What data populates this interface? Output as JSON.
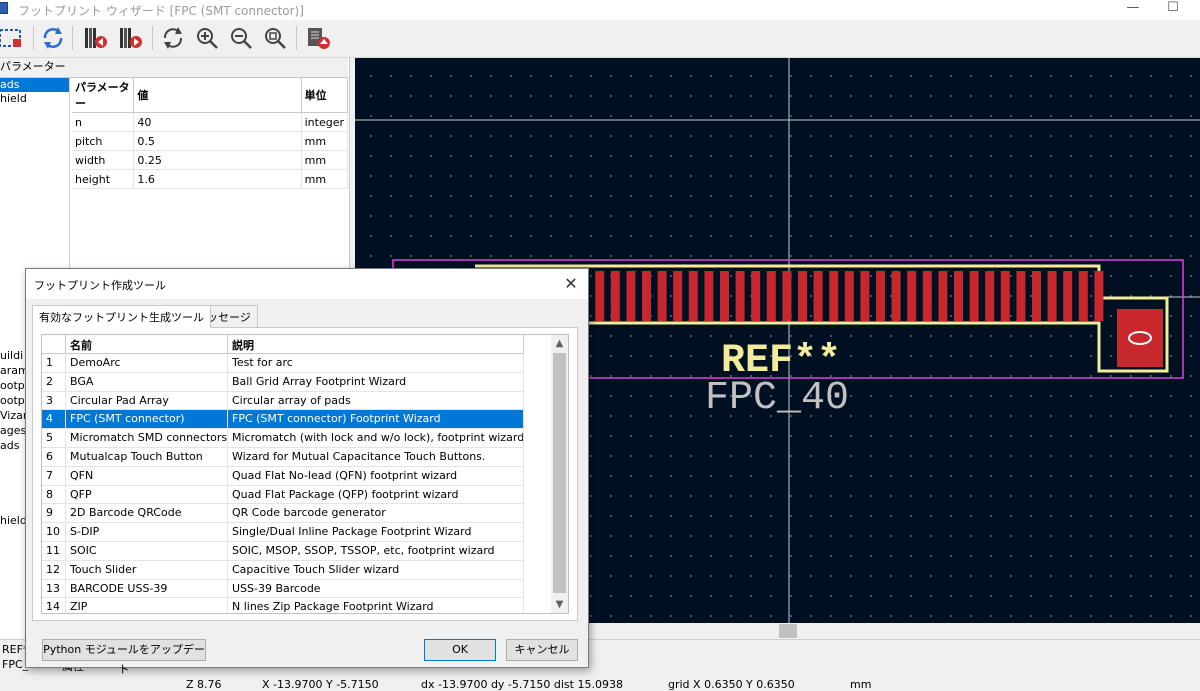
{
  "window": {
    "title": "フットプリント ウィザード [FPC (SMT connector)]",
    "minimize": "—",
    "maximize": "☐"
  },
  "left_panel": {
    "header": "パラメーター",
    "pages": [
      "ads",
      "hield"
    ],
    "selected_page": 0,
    "columns": [
      "パラメーター",
      "値",
      "単位"
    ],
    "params": [
      {
        "name": "n",
        "value": "40",
        "unit": "integer"
      },
      {
        "name": "pitch",
        "value": "0.5",
        "unit": "mm"
      },
      {
        "name": "width",
        "value": "0.25",
        "unit": "mm"
      },
      {
        "name": "height",
        "value": "1.6",
        "unit": "mm"
      }
    ],
    "messages": [
      "uildi",
      "aram",
      "ootpr",
      "ootpr",
      "Vizarc",
      "ages:",
      "ads",
      "",
      "",
      "",
      "",
      "hield"
    ]
  },
  "canvas": {
    "ref_text": "REF**",
    "value_text": "FPC_40",
    "pad_count": 40,
    "pad_number": "0",
    "colors": {
      "background": "#001023",
      "pad": "#c8282d",
      "silk": "#f2ec9b",
      "courtyard": "#e040e0",
      "fab": "#c2c2c2"
    }
  },
  "status_bar": {
    "ref_line": "REF*",
    "fpc_line": "FPC_4",
    "field_label": "属性",
    "z": "Z 8.76",
    "xy": "X -13.9700  Y -5.7150",
    "delta": "dx -13.9700  dy -5.7150  dist 15.0938",
    "grid": "grid X 0.6350  Y 0.6350",
    "units": "mm"
  },
  "dialog": {
    "title": "フットプリント作成ツール",
    "tabs": [
      "有効なフットプリント生成ツール",
      "メッセージ"
    ],
    "active_tab": 0,
    "columns": [
      "名前",
      "説明"
    ],
    "rows": [
      {
        "num": "1",
        "name": "DemoArc",
        "desc": "Test for arc"
      },
      {
        "num": "2",
        "name": "BGA",
        "desc": "Ball Grid Array Footprint Wizard"
      },
      {
        "num": "3",
        "name": "Circular Pad Array",
        "desc": "Circular array of pads"
      },
      {
        "num": "4",
        "name": "FPC (SMT connector)",
        "desc": "FPC (SMT connector) Footprint Wizard"
      },
      {
        "num": "5",
        "name": "Micromatch SMD connectors",
        "desc": "Micromatch (with lock and w/o lock), footprint wizard"
      },
      {
        "num": "6",
        "name": "Mutualcap Touch Button",
        "desc": "Wizard for Mutual Capacitance Touch Buttons."
      },
      {
        "num": "7",
        "name": "QFN",
        "desc": "Quad Flat No-lead (QFN) footprint wizard"
      },
      {
        "num": "8",
        "name": "QFP",
        "desc": "Quad Flat Package (QFP) footprint wizard"
      },
      {
        "num": "9",
        "name": "2D Barcode QRCode",
        "desc": "QR Code barcode generator"
      },
      {
        "num": "10",
        "name": "S-DIP",
        "desc": "Single/Dual Inline Package Footprint Wizard"
      },
      {
        "num": "11",
        "name": "SOIC",
        "desc": "SOIC, MSOP, SSOP, TSSOP, etc, footprint wizard"
      },
      {
        "num": "12",
        "name": "Touch Slider",
        "desc": "Capacitive Touch Slider wizard"
      },
      {
        "num": "13",
        "name": "BARCODE USS-39",
        "desc": "USS-39 Barcode"
      },
      {
        "num": "14",
        "name": "ZIP",
        "desc": "N lines Zip Package Footprint Wizard"
      }
    ],
    "selected_row": 3,
    "update_button": "Python モジュールをアップデート",
    "ok_button": "OK",
    "cancel_button": "キャンセル",
    "close": "✕"
  },
  "toolbar": {
    "icons": [
      "footprint-select-icon",
      "refresh-icon",
      "prev-page-icon",
      "next-page-icon",
      "redraw-icon",
      "zoom-in-icon",
      "zoom-out-icon",
      "zoom-fit-icon",
      "export-icon"
    ]
  }
}
